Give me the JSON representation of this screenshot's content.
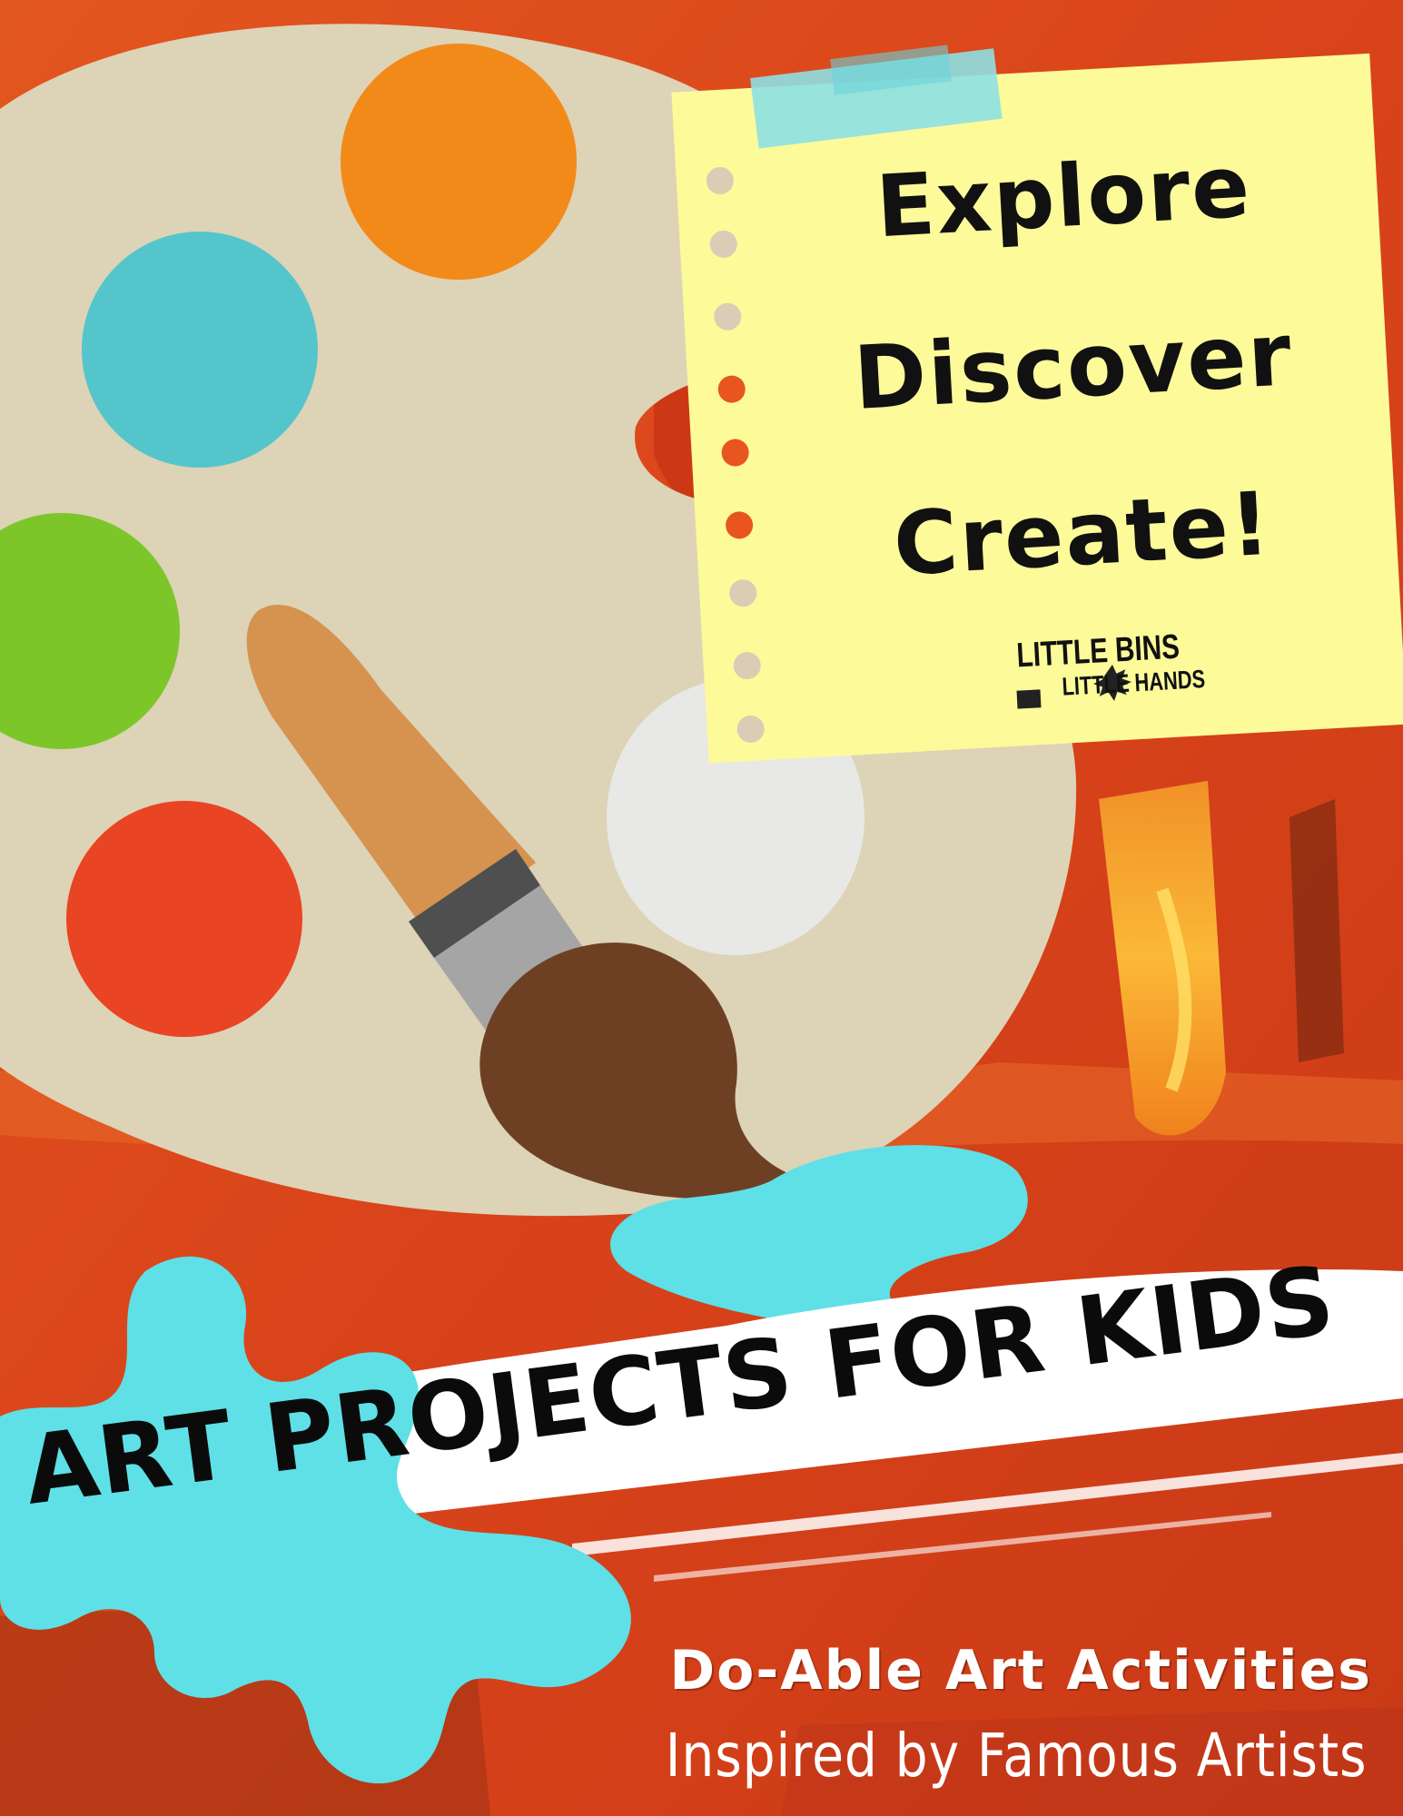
{
  "note": {
    "line1": "Explore",
    "line2": "Discover",
    "line3": "Create!"
  },
  "logo": {
    "line1": "LITTLE BINS",
    "line2": "LITTLE HANDS"
  },
  "banner": {
    "title": "ART PROJECTS FOR KIDS"
  },
  "subtitle": {
    "line1": "Do-Able Art Activities",
    "line2": "Inspired by Famous Artists"
  },
  "colors": {
    "background": "#d94a1c",
    "palette": "#ddd3b7",
    "orange_dot": "#f28a1a",
    "blue_dot": "#55c5cc",
    "green_dot": "#7cc62a",
    "red_dot": "#e94423",
    "white_dot": "#e8e8e6",
    "note": "#fdfa9a",
    "tape": "#8ee0e4",
    "brush_handle": "#d5934f",
    "brush_tip": "#6e4023",
    "splash": "#5ee0e6"
  }
}
